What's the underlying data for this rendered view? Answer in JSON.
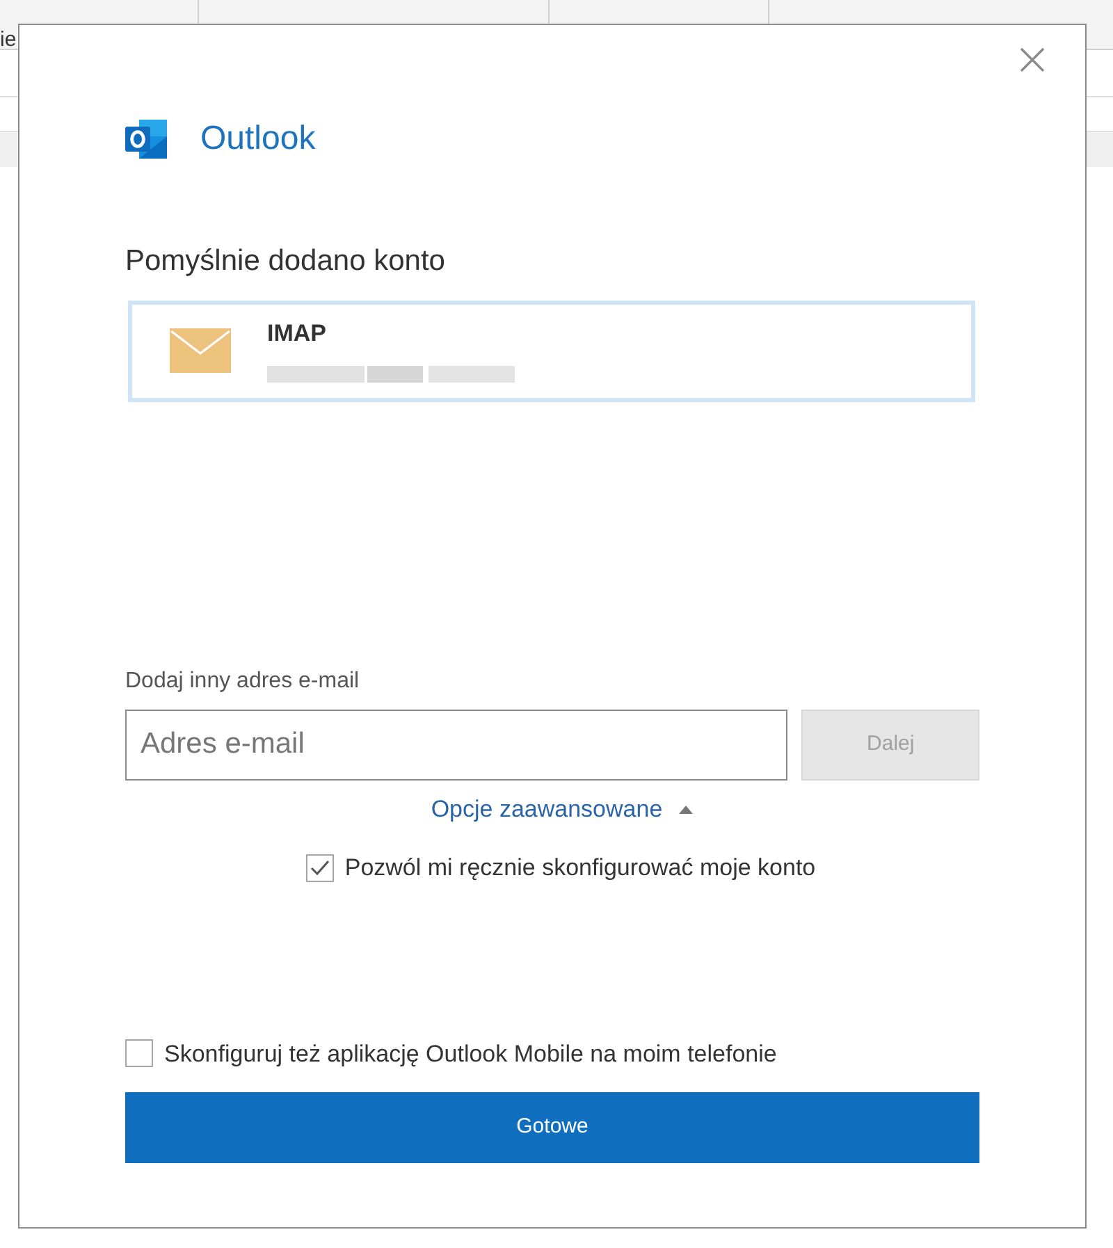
{
  "background": {
    "cell_text": "ie"
  },
  "dialog": {
    "app_name": "Outlook",
    "heading": "Pomyślnie dodano konto",
    "account": {
      "type": "IMAP"
    },
    "add_label": "Dodaj inny adres e-mail",
    "email_field": {
      "placeholder": "Adres e-mail"
    },
    "next_button": {
      "label": "Dalej",
      "disabled": true
    },
    "advanced_link": {
      "label": "Opcje zaawansowane",
      "expanded": true
    },
    "manual_setup": {
      "label": "Pozwól mi ręcznie skonfigurować moje konto",
      "checked": true
    },
    "mobile_setup": {
      "label": "Skonfiguruj też aplikację Outlook Mobile na moim telefonie",
      "checked": false
    },
    "done_button": {
      "label": "Gotowe"
    }
  }
}
